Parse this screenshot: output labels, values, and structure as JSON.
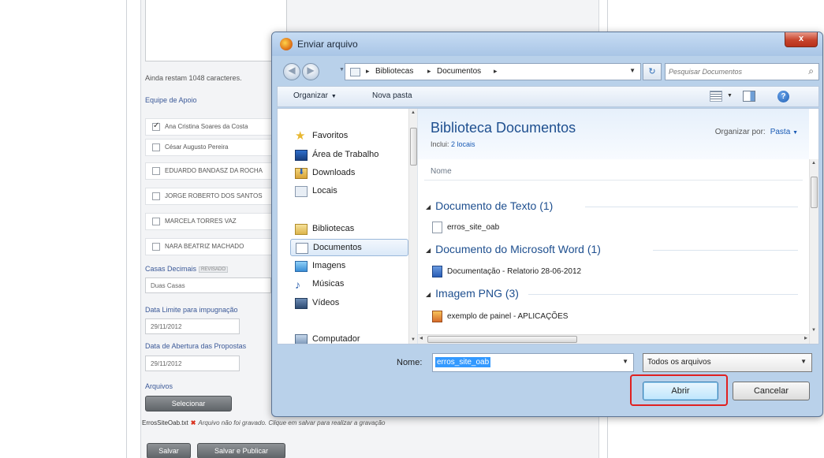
{
  "background": {
    "char_counter": "Ainda restam 1048 caracteres.",
    "team_label": "Equipe de Apoio",
    "team_members": [
      {
        "name": "Ana Cristina Soares da Costa",
        "checked": true
      },
      {
        "name": "César Augusto Pereira",
        "checked": false
      },
      {
        "name": "EDUARDO BANDASZ DA ROCHA",
        "checked": false
      },
      {
        "name": "JORGE ROBERTO DOS SANTOS",
        "checked": false
      },
      {
        "name": "MARCELA TORRES VAZ",
        "checked": false
      },
      {
        "name": "NARA BEATRIZ MACHADO",
        "checked": false
      }
    ],
    "decimals_label": "Casas Decimais",
    "decimals_badge": "REVISADO",
    "decimals_value": "Duas Casas",
    "deadline_label": "Data Limite para impugnação",
    "deadline_value": "29/11/2012",
    "opening_label": "Data de Abertura das Propostas",
    "opening_value": "29/11/2012",
    "files_label": "Arquivos",
    "select_button": "Selecionar",
    "status_file": "ErrosSiteOab.txt",
    "status_message": "Arquivo não foi gravado. Clique em salvar para realizar a gravação",
    "save_button": "Salvar",
    "save_publish_button": "Salvar e Publicar"
  },
  "dialog": {
    "title": "Enviar arquivo",
    "close_label": "x",
    "address": {
      "crumb1": "Bibliotecas",
      "crumb2": "Documentos"
    },
    "search_placeholder": "Pesquisar Documentos",
    "toolbar": {
      "organize": "Organizar",
      "new_folder": "Nova pasta"
    },
    "nav": {
      "favorites": "Favoritos",
      "desktop": "Área de Trabalho",
      "downloads": "Downloads",
      "locais": "Locais",
      "libraries": "Bibliotecas",
      "documents": "Documentos",
      "images": "Imagens",
      "music": "Músicas",
      "videos": "Vídeos",
      "computer": "Computador"
    },
    "library_title": "Biblioteca Documentos",
    "includes_label": "Inclui:",
    "includes_link": "2 locais",
    "arrange_label": "Organizar por:",
    "arrange_value": "Pasta",
    "column_name": "Nome",
    "groups": [
      {
        "title": "Documento de Texto (1)",
        "file": "erros_site_oab"
      },
      {
        "title": "Documento do Microsoft Word (1)",
        "file": "Documentação - Relatorio 28-06-2012"
      },
      {
        "title": "Imagem PNG (3)",
        "file": "exemplo de painel - APLICAÇÕES"
      }
    ],
    "filename_label": "Nome:",
    "filename_value": "erros_site_oab",
    "filetype_value": "Todos os arquivos",
    "open_button": "Abrir",
    "cancel_button": "Cancelar"
  },
  "colors": {
    "highlight": "#e02020",
    "titlebar": "#b9d1ea",
    "link": "#1a5bb5"
  }
}
